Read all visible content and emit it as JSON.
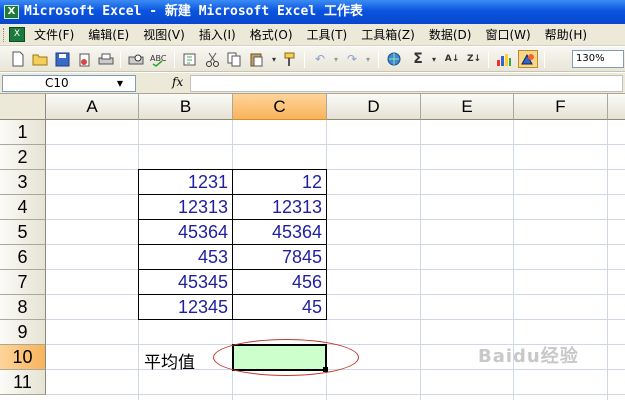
{
  "window": {
    "title": "Microsoft Excel - 新建 Microsoft Excel 工作表",
    "app_icon": "excel-icon"
  },
  "menu": {
    "items": [
      "文件(F)",
      "编辑(E)",
      "视图(V)",
      "插入(I)",
      "格式(O)",
      "工具(T)",
      "工具箱(Z)",
      "数据(D)",
      "窗口(W)",
      "帮助(H)"
    ]
  },
  "toolbar": {
    "icons": [
      "new-icon",
      "open-icon",
      "save-icon",
      "permission-icon",
      "print-icon",
      "print-preview-icon",
      "spelling-icon",
      "cut-icon",
      "copy-icon",
      "paste-icon",
      "format-painter-icon",
      "undo-icon",
      "redo-icon",
      "hyperlink-icon",
      "autosum-icon",
      "sort-ascending-icon",
      "sort-descending-icon",
      "chart-wizard-icon",
      "drawing-icon"
    ],
    "zoom": "130%"
  },
  "formula_bar": {
    "name_box": "C10",
    "fx": "fx",
    "formula": ""
  },
  "sheet": {
    "columns": [
      "A",
      "B",
      "C",
      "D",
      "E",
      "F"
    ],
    "active_column": "C",
    "rows": [
      "1",
      "2",
      "3",
      "4",
      "5",
      "6",
      "7",
      "8",
      "9",
      "10",
      "11"
    ],
    "active_row": "10",
    "table": [
      {
        "B": "1231",
        "C": "12"
      },
      {
        "B": "12313",
        "C": "12313"
      },
      {
        "B": "45364",
        "C": "45364"
      },
      {
        "B": "453",
        "C": "7845"
      },
      {
        "B": "45345",
        "C": "456"
      },
      {
        "B": "12345",
        "C": "45"
      }
    ],
    "average_label": "平均值",
    "active_cell_value": "",
    "active_cell_fill": "#ccffcc",
    "highlight_ellipse_color": "#c0392b"
  },
  "watermark": "Baidu经验"
}
